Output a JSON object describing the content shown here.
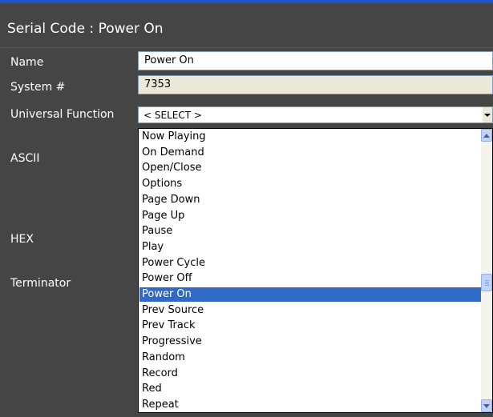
{
  "dialog": {
    "title": "Serial Code : Power On"
  },
  "form": {
    "name_label": "Name",
    "name_value": "Power On",
    "system_label": "System #",
    "system_value": "7353",
    "universal_function_label": "Universal Function",
    "ascii_label": "ASCII",
    "hex_label": "HEX",
    "terminator_label": "Terminator"
  },
  "universal_function_select": {
    "value": "< SELECT >",
    "selected_option": "Power On",
    "scroll_position": 0.55,
    "visible_options": [
      "Now Playing",
      "On Demand",
      "Open/Close",
      "Options",
      "Page Down",
      "Page Up",
      "Pause",
      "Play",
      "Power Cycle",
      "Power Off",
      "Power On",
      "Prev Source",
      "Prev Track",
      "Progressive",
      "Random",
      "Record",
      "Red",
      "Repeat"
    ]
  },
  "colors": {
    "panel_background": "#454545",
    "highlight": "#316ac5",
    "title_accent": "#1b55c9"
  }
}
